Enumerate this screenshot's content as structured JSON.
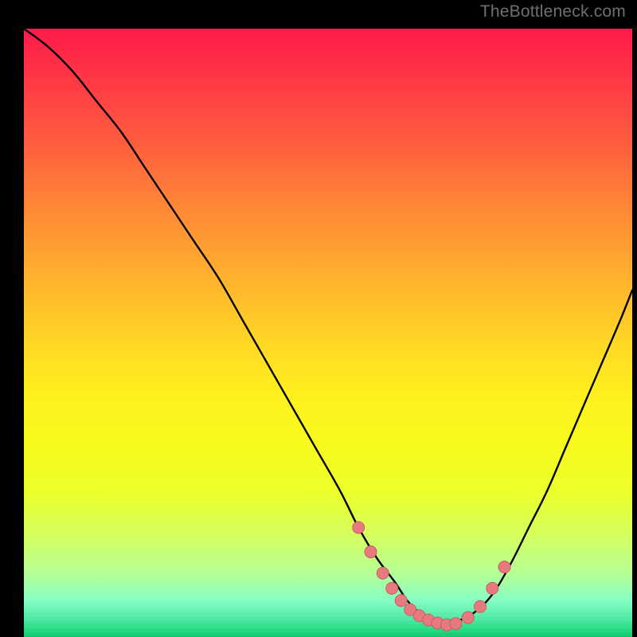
{
  "attribution": "TheBottleneck.com",
  "colors": {
    "background": "#000000",
    "curve": "#000000",
    "marker_fill": "#e77a7e",
    "marker_stroke": "#c95e63"
  },
  "chart_data": {
    "type": "line",
    "title": "",
    "xlabel": "",
    "ylabel": "",
    "xlim": [
      0,
      100
    ],
    "ylim": [
      0,
      100
    ],
    "grid": false,
    "legend": false,
    "series": [
      {
        "name": "bottleneck-curve",
        "x": [
          0,
          4,
          8,
          12,
          16,
          20,
          24,
          28,
          32,
          36,
          40,
          44,
          48,
          52,
          55,
          58,
          61,
          63,
          65,
          67,
          69,
          71,
          74,
          77,
          80,
          83,
          86,
          89,
          92,
          95,
          98,
          100
        ],
        "values": [
          100,
          97,
          93,
          88,
          83,
          77,
          71,
          65,
          59,
          52,
          45,
          38,
          31,
          24,
          18,
          13,
          9,
          6,
          4,
          2.5,
          2,
          2.5,
          4,
          7,
          12,
          18,
          24,
          31,
          38,
          45,
          52,
          57
        ]
      }
    ],
    "markers": {
      "name": "marker-points",
      "x": [
        55,
        57,
        59,
        60.5,
        62,
        63.5,
        65,
        66.5,
        68,
        69.5,
        71,
        73,
        75,
        77,
        79
      ],
      "values": [
        18,
        14,
        10.5,
        8,
        6,
        4.5,
        3.5,
        2.8,
        2.3,
        2,
        2.2,
        3.2,
        5,
        8,
        11.5
      ]
    }
  }
}
